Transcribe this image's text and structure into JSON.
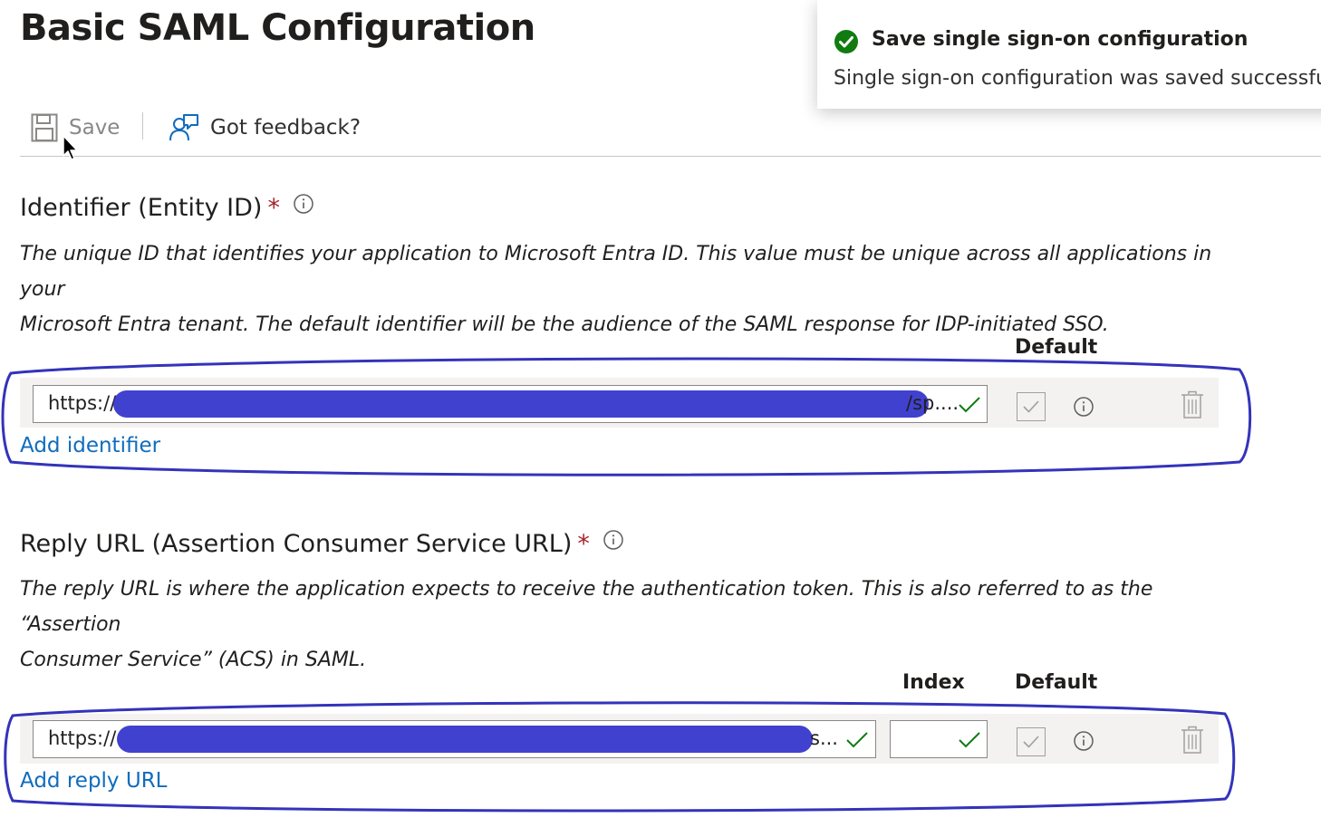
{
  "page": {
    "title": "Basic SAML Configuration"
  },
  "toolbar": {
    "save_label": "Save",
    "feedback_label": "Got feedback?"
  },
  "notification": {
    "title": "Save single sign-on configuration",
    "message": "Single sign-on configuration was saved successfully."
  },
  "identifier": {
    "title": "Identifier (Entity ID)",
    "required_mark": "*",
    "description_line1": "The unique ID that identifies your application to Microsoft Entra ID. This value must be unique across all applications in your",
    "description_line2": "Microsoft Entra tenant. The default identifier will be the audience of the SAML response for IDP-initiated SSO.",
    "default_header": "Default",
    "value_prefix": "https://",
    "value_suffix": "/sp....",
    "add_link": "Add identifier"
  },
  "reply_url": {
    "title": "Reply URL (Assertion Consumer Service URL)",
    "required_mark": "*",
    "description_line1": "The reply URL is where the application expects to receive the authentication token. This is also referred to as the “Assertion",
    "description_line2": "Consumer Service” (ACS) in SAML.",
    "index_header": "Index",
    "default_header": "Default",
    "value_prefix": "https://",
    "value_suffix": "s...",
    "index_value": "",
    "add_link": "Add reply URL"
  },
  "colors": {
    "link": "#0f6cbd",
    "success": "#107c10",
    "required": "#a4262c",
    "annotation": "#3333bb"
  },
  "icons": {
    "save": "save-icon",
    "feedback": "feedback-icon",
    "success": "success-check-icon",
    "info": "info-icon",
    "valid": "valid-check-icon",
    "delete": "trash-icon",
    "cursor": "mouse-cursor-icon"
  }
}
